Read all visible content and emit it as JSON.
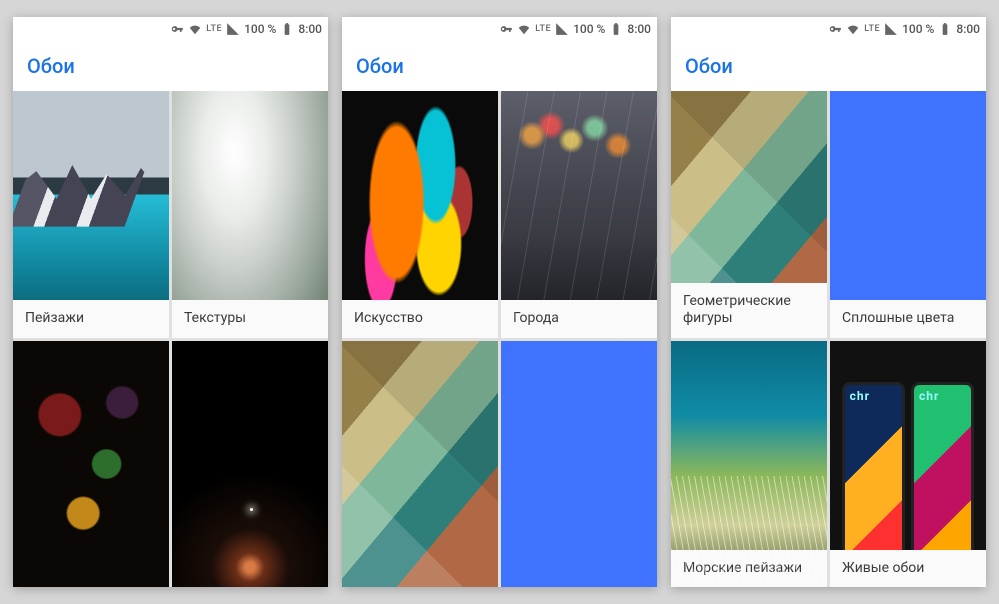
{
  "status": {
    "vpn_icon": "key-icon",
    "wifi_icon": "wifi-icon",
    "lte_label": "LTE",
    "signal_icon": "signal-icon",
    "battery_text": "100 %",
    "battery_icon": "battery-icon",
    "time": "8:00"
  },
  "app": {
    "title": "Обои"
  },
  "phones": [
    {
      "tiles": [
        {
          "label": "Пейзажи",
          "thumb": "thumb-landscape"
        },
        {
          "label": "Текстуры",
          "thumb": "thumb-texture"
        },
        {
          "label": "",
          "thumb": "thumb-leaves"
        },
        {
          "label": "",
          "thumb": "thumb-space"
        }
      ]
    },
    {
      "tiles": [
        {
          "label": "Искусство",
          "thumb": "thumb-art"
        },
        {
          "label": "Города",
          "thumb": "thumb-city"
        },
        {
          "label": "",
          "thumb": "thumb-poly"
        },
        {
          "label": "",
          "thumb": "thumb-solid"
        }
      ]
    },
    {
      "tiles": [
        {
          "label": "Геометрические фигуры",
          "thumb": "thumb-poly"
        },
        {
          "label": "Сплошные цвета",
          "thumb": "thumb-solid"
        },
        {
          "label": "Морские пейзажи",
          "thumb": "thumb-sea"
        },
        {
          "label": "Живые обои",
          "thumb": "thumb-live"
        }
      ]
    }
  ]
}
